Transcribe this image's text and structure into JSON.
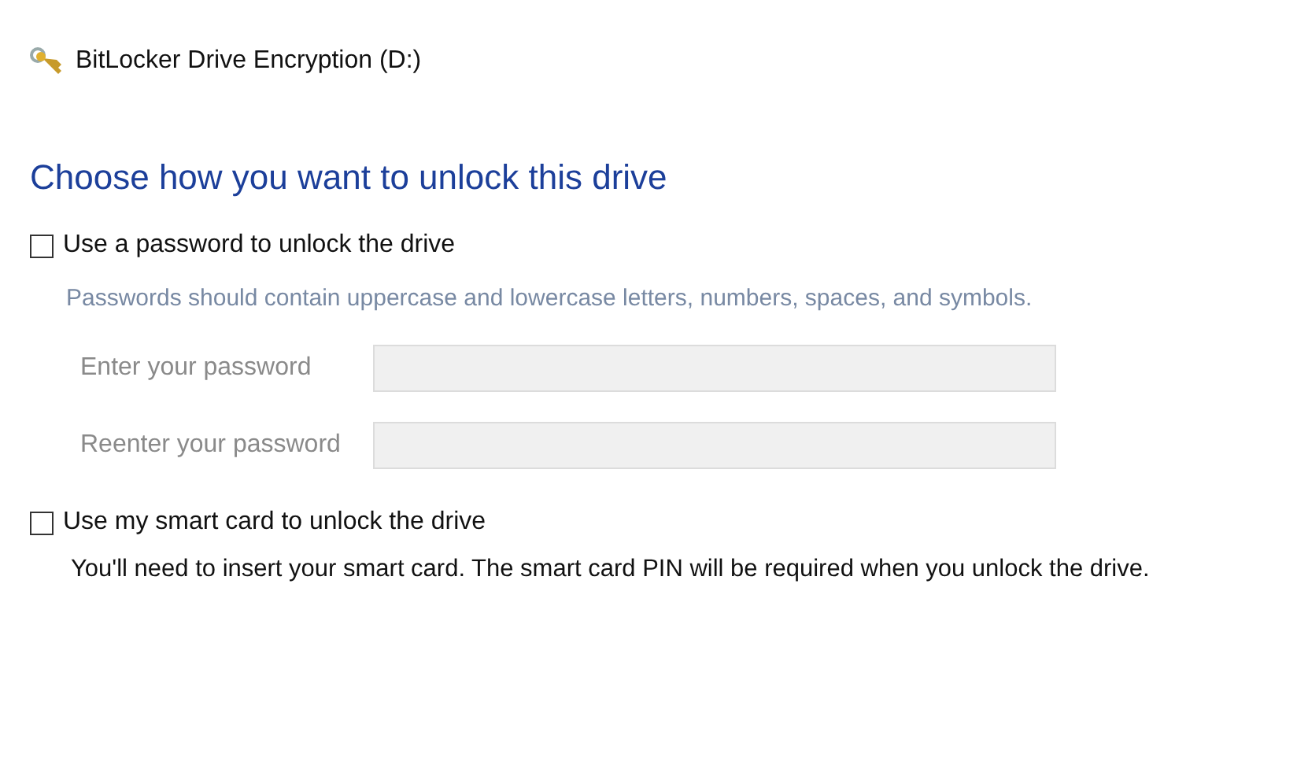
{
  "window": {
    "title": "BitLocker Drive Encryption (D:)"
  },
  "heading": "Choose how you want to unlock this drive",
  "password_option": {
    "label": "Use a password to unlock the drive",
    "checked": false,
    "hint": "Passwords should contain uppercase and lowercase letters, numbers, spaces, and symbols.",
    "fields": [
      {
        "label": "Enter your password",
        "disabled": true
      },
      {
        "label": "Reenter your password",
        "disabled": true
      }
    ]
  },
  "smart_card_option": {
    "label": "Use my smart card to unlock the drive",
    "checked": false,
    "description": "You'll need to insert your smart card. The smart card PIN will be required when you unlock the drive."
  }
}
